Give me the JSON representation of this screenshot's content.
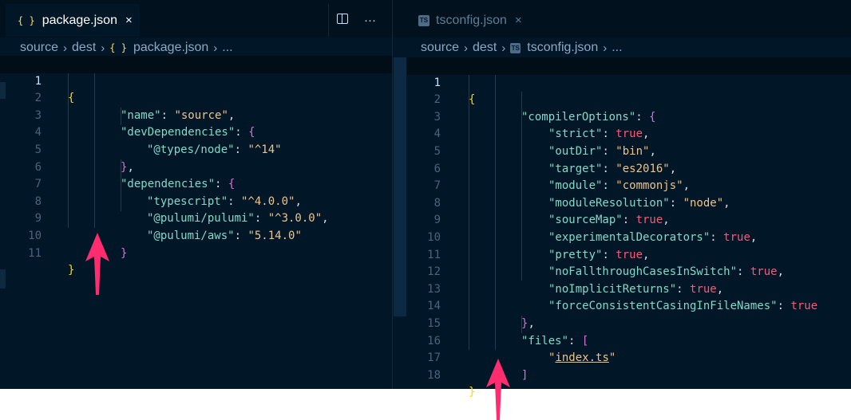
{
  "colors": {
    "pink_arrow": "#ff2d6f",
    "editor_bg": "#011627"
  },
  "left_pane": {
    "tab": {
      "icon": "{ }",
      "label": "package.json",
      "close": "×"
    },
    "actions": {
      "split": "split-editor-icon",
      "more": "···"
    },
    "breadcrumb": {
      "p1": "source",
      "p2": "dest",
      "icon": "{ }",
      "p3": "package.json",
      "p4": "..."
    },
    "lines": [
      {
        "n": "1"
      },
      {
        "n": "2"
      },
      {
        "n": "3"
      },
      {
        "n": "4"
      },
      {
        "n": "5"
      },
      {
        "n": "6"
      },
      {
        "n": "7"
      },
      {
        "n": "8"
      },
      {
        "n": "9"
      },
      {
        "n": "10"
      },
      {
        "n": "11"
      }
    ],
    "tokens": {
      "open": "{",
      "name_key": "\"name\"",
      "name_val": "\"source\"",
      "devdeps_key": "\"devDependencies\"",
      "types_node_key": "\"@types/node\"",
      "types_node_val": "\"^14\"",
      "close_inner": "}",
      "deps_key": "\"dependencies\"",
      "typescript_key": "\"typescript\"",
      "typescript_val": "\"^4.0.0\"",
      "pulumi_key": "\"@pulumi/pulumi\"",
      "pulumi_val": "\"^3.0.0\"",
      "aws_key": "\"@pulumi/aws\"",
      "aws_val": "\"5.14.0\"",
      "close": "}"
    }
  },
  "right_pane": {
    "tab": {
      "icon": "TS",
      "label": "tsconfig.json",
      "close": "×"
    },
    "breadcrumb": {
      "p1": "source",
      "p2": "dest",
      "icon": "TS",
      "p3": "tsconfig.json",
      "p4": "..."
    },
    "lines": [
      {
        "n": "1"
      },
      {
        "n": "2"
      },
      {
        "n": "3"
      },
      {
        "n": "4"
      },
      {
        "n": "5"
      },
      {
        "n": "6"
      },
      {
        "n": "7"
      },
      {
        "n": "8"
      },
      {
        "n": "9"
      },
      {
        "n": "10"
      },
      {
        "n": "11"
      },
      {
        "n": "12"
      },
      {
        "n": "13"
      },
      {
        "n": "14"
      },
      {
        "n": "15"
      },
      {
        "n": "16"
      },
      {
        "n": "17"
      },
      {
        "n": "18"
      }
    ],
    "tokens": {
      "open": "{",
      "compiler_key": "\"compilerOptions\"",
      "strict_key": "\"strict\"",
      "strict_val": "true",
      "outdir_key": "\"outDir\"",
      "outdir_val": "\"bin\"",
      "target_key": "\"target\"",
      "target_val": "\"es2016\"",
      "module_key": "\"module\"",
      "module_val": "\"commonjs\"",
      "modres_key": "\"moduleResolution\"",
      "modres_val": "\"node\"",
      "sourcemap_key": "\"sourceMap\"",
      "sourcemap_val": "true",
      "expdec_key": "\"experimentalDecorators\"",
      "expdec_val": "true",
      "pretty_key": "\"pretty\"",
      "pretty_val": "true",
      "nofall_key": "\"noFallthroughCasesInSwitch\"",
      "nofall_val": "true",
      "noimpl_key": "\"noImplicitReturns\"",
      "noimpl_val": "true",
      "force_key": "\"forceConsistentCasingInFileNames\"",
      "force_val": "true",
      "close_inner": "}",
      "files_key": "\"files\"",
      "open_arr": "[",
      "file_q1": "\"",
      "file_name": "index.ts",
      "file_q2": "\"",
      "close_arr": "]",
      "close": "}"
    }
  },
  "punct": {
    "colon": ": ",
    "comma": ",",
    "open_obj": "{",
    "open_arr": "["
  }
}
